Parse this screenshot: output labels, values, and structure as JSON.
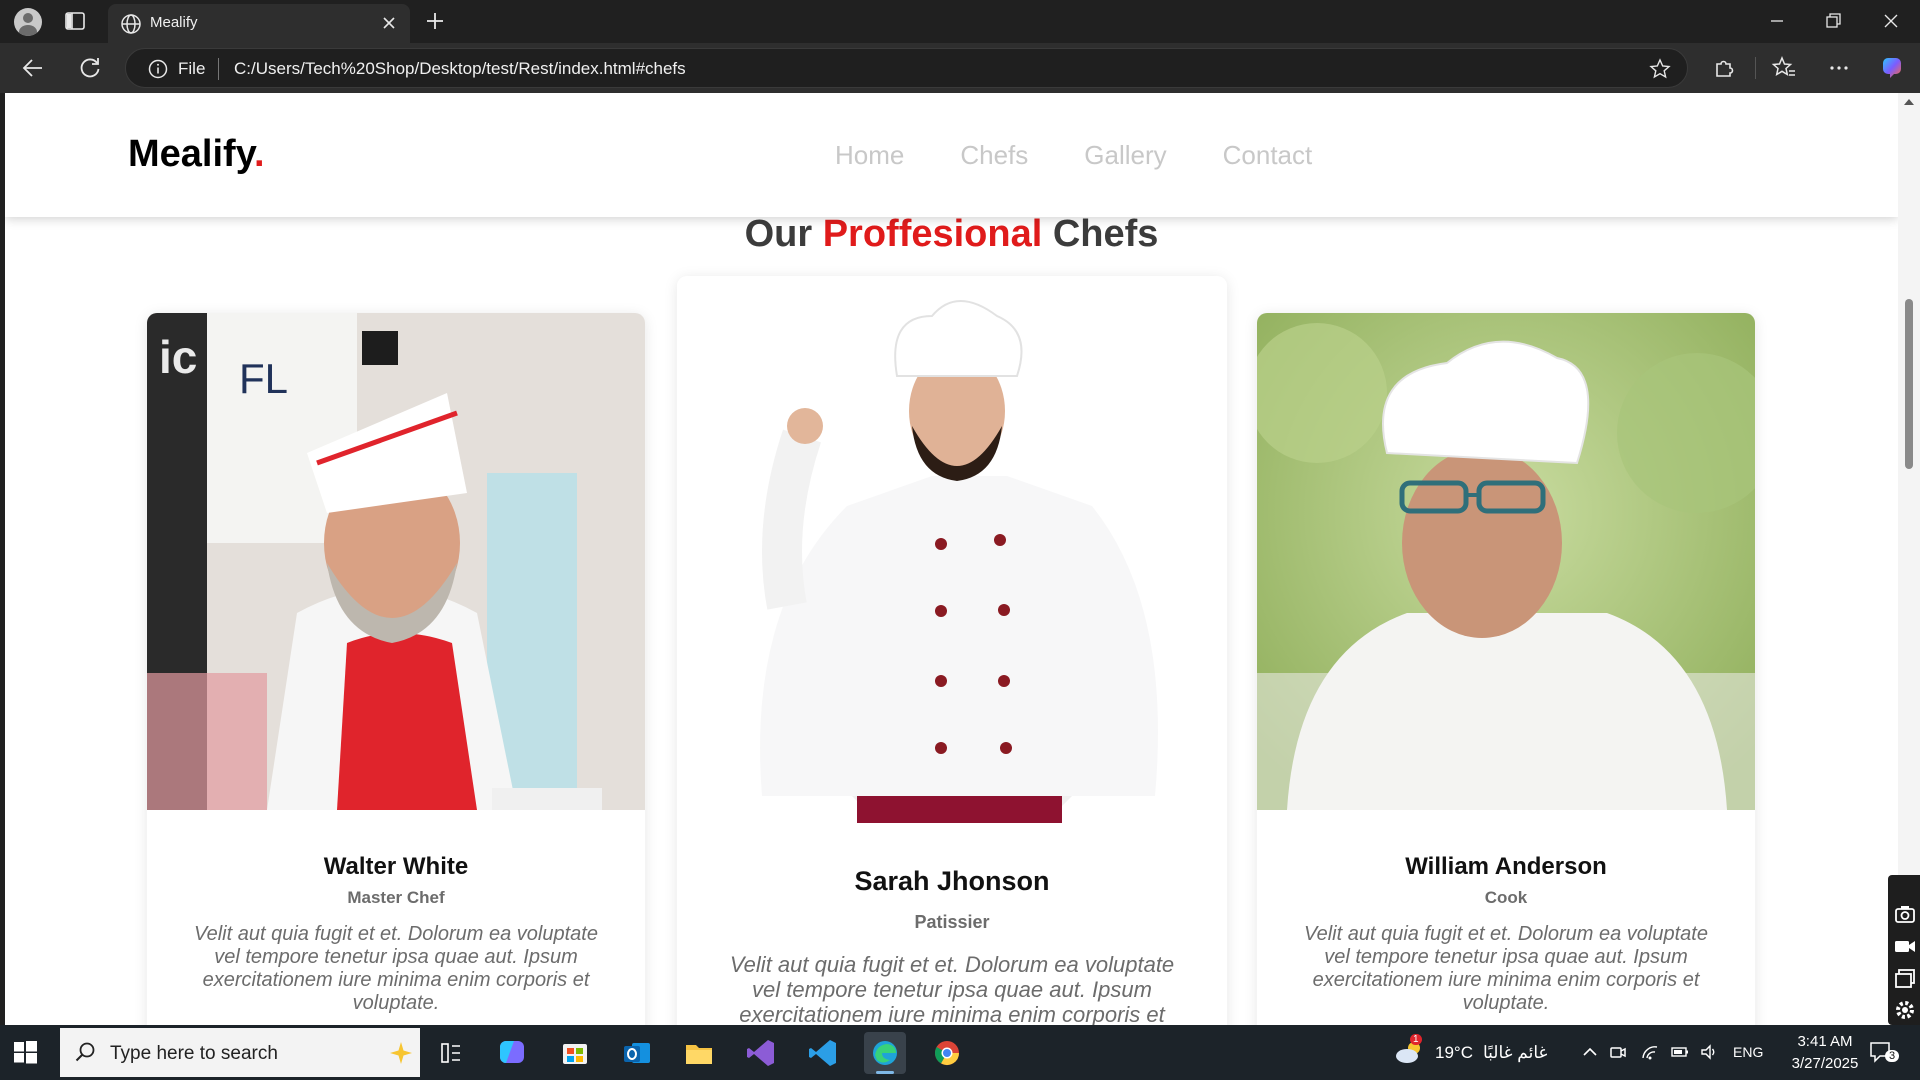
{
  "browser": {
    "tab_title": "Mealify",
    "address_scheme": "File",
    "address_url": "C:/Users/Tech%20Shop/Desktop/test/Rest/index.html#chefs"
  },
  "site": {
    "logo": "Mealify",
    "logo_dot": ".",
    "nav": [
      "Home",
      "Chefs",
      "Gallery",
      "Contact"
    ],
    "section_title": {
      "prefix": "Our",
      "accent": "Proffesional",
      "suffix": "Chefs"
    },
    "chefs": [
      {
        "name": "Walter White",
        "role": "Master Chef",
        "description": "Velit aut quia fugit et et. Dolorum ea voluptate vel tempore tenetur ipsa quae aut. Ipsum exercitationem iure minima enim corporis et voluptate."
      },
      {
        "name": "Sarah Jhonson",
        "role": "Patissier",
        "description": "Velit aut quia fugit et et. Dolorum ea voluptate vel tempore tenetur ipsa quae aut. Ipsum exercitationem iure minima enim corporis et voluptate."
      },
      {
        "name": "William Anderson",
        "role": "Cook",
        "description": "Velit aut quia fugit et et. Dolorum ea voluptate vel tempore tenetur ipsa quae aut. Ipsum exercitationem iure minima enim corporis et voluptate."
      }
    ]
  },
  "taskbar": {
    "search_placeholder": "Type here to search",
    "weather_temp": "19°C",
    "weather_desc": "غائم غالبًا",
    "weather_badge": "1",
    "language": "ENG",
    "time": "3:41 AM",
    "date": "3/27/2025",
    "notification_count": "3"
  },
  "colors": {
    "accent": "#e01b1b",
    "nav_text": "#c8c8c8",
    "muted_text": "#6c6c6c"
  }
}
